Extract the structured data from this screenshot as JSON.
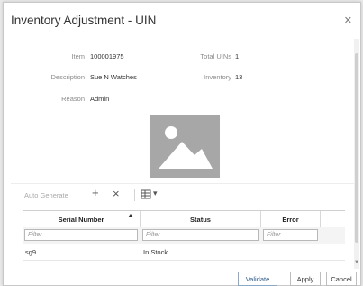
{
  "dialog": {
    "title": "Inventory Adjustment - UIN",
    "close_icon": "close-icon"
  },
  "fields": {
    "item_label": "Item",
    "item_value": "100001975",
    "total_uins_label": "Total UINs",
    "total_uins_value": "1",
    "description_label": "Description",
    "description_value": "Sue N Watches",
    "inventory_label": "Inventory",
    "inventory_value": "13",
    "reason_label": "Reason",
    "reason_value": "Admin"
  },
  "image": {
    "icon": "image-placeholder-icon",
    "color": "#a7a7a7"
  },
  "toolbar": {
    "auto_generate": "Auto Generate",
    "add": "+",
    "remove": "×",
    "view_icon": "table-view-icon",
    "dropdown": "▾"
  },
  "table": {
    "columns": [
      "Serial Number",
      "Status",
      "Error"
    ],
    "filter_placeholder": "Filter",
    "rows": [
      {
        "serial": "sg9",
        "status": "In Stock",
        "error": ""
      }
    ]
  },
  "footer": {
    "validate": "Validate",
    "apply": "Apply",
    "cancel": "Cancel"
  },
  "colors": {
    "primary_text": "#2e5c8a",
    "border": "#bdbdbd",
    "placeholder": "#a7a7a7"
  }
}
